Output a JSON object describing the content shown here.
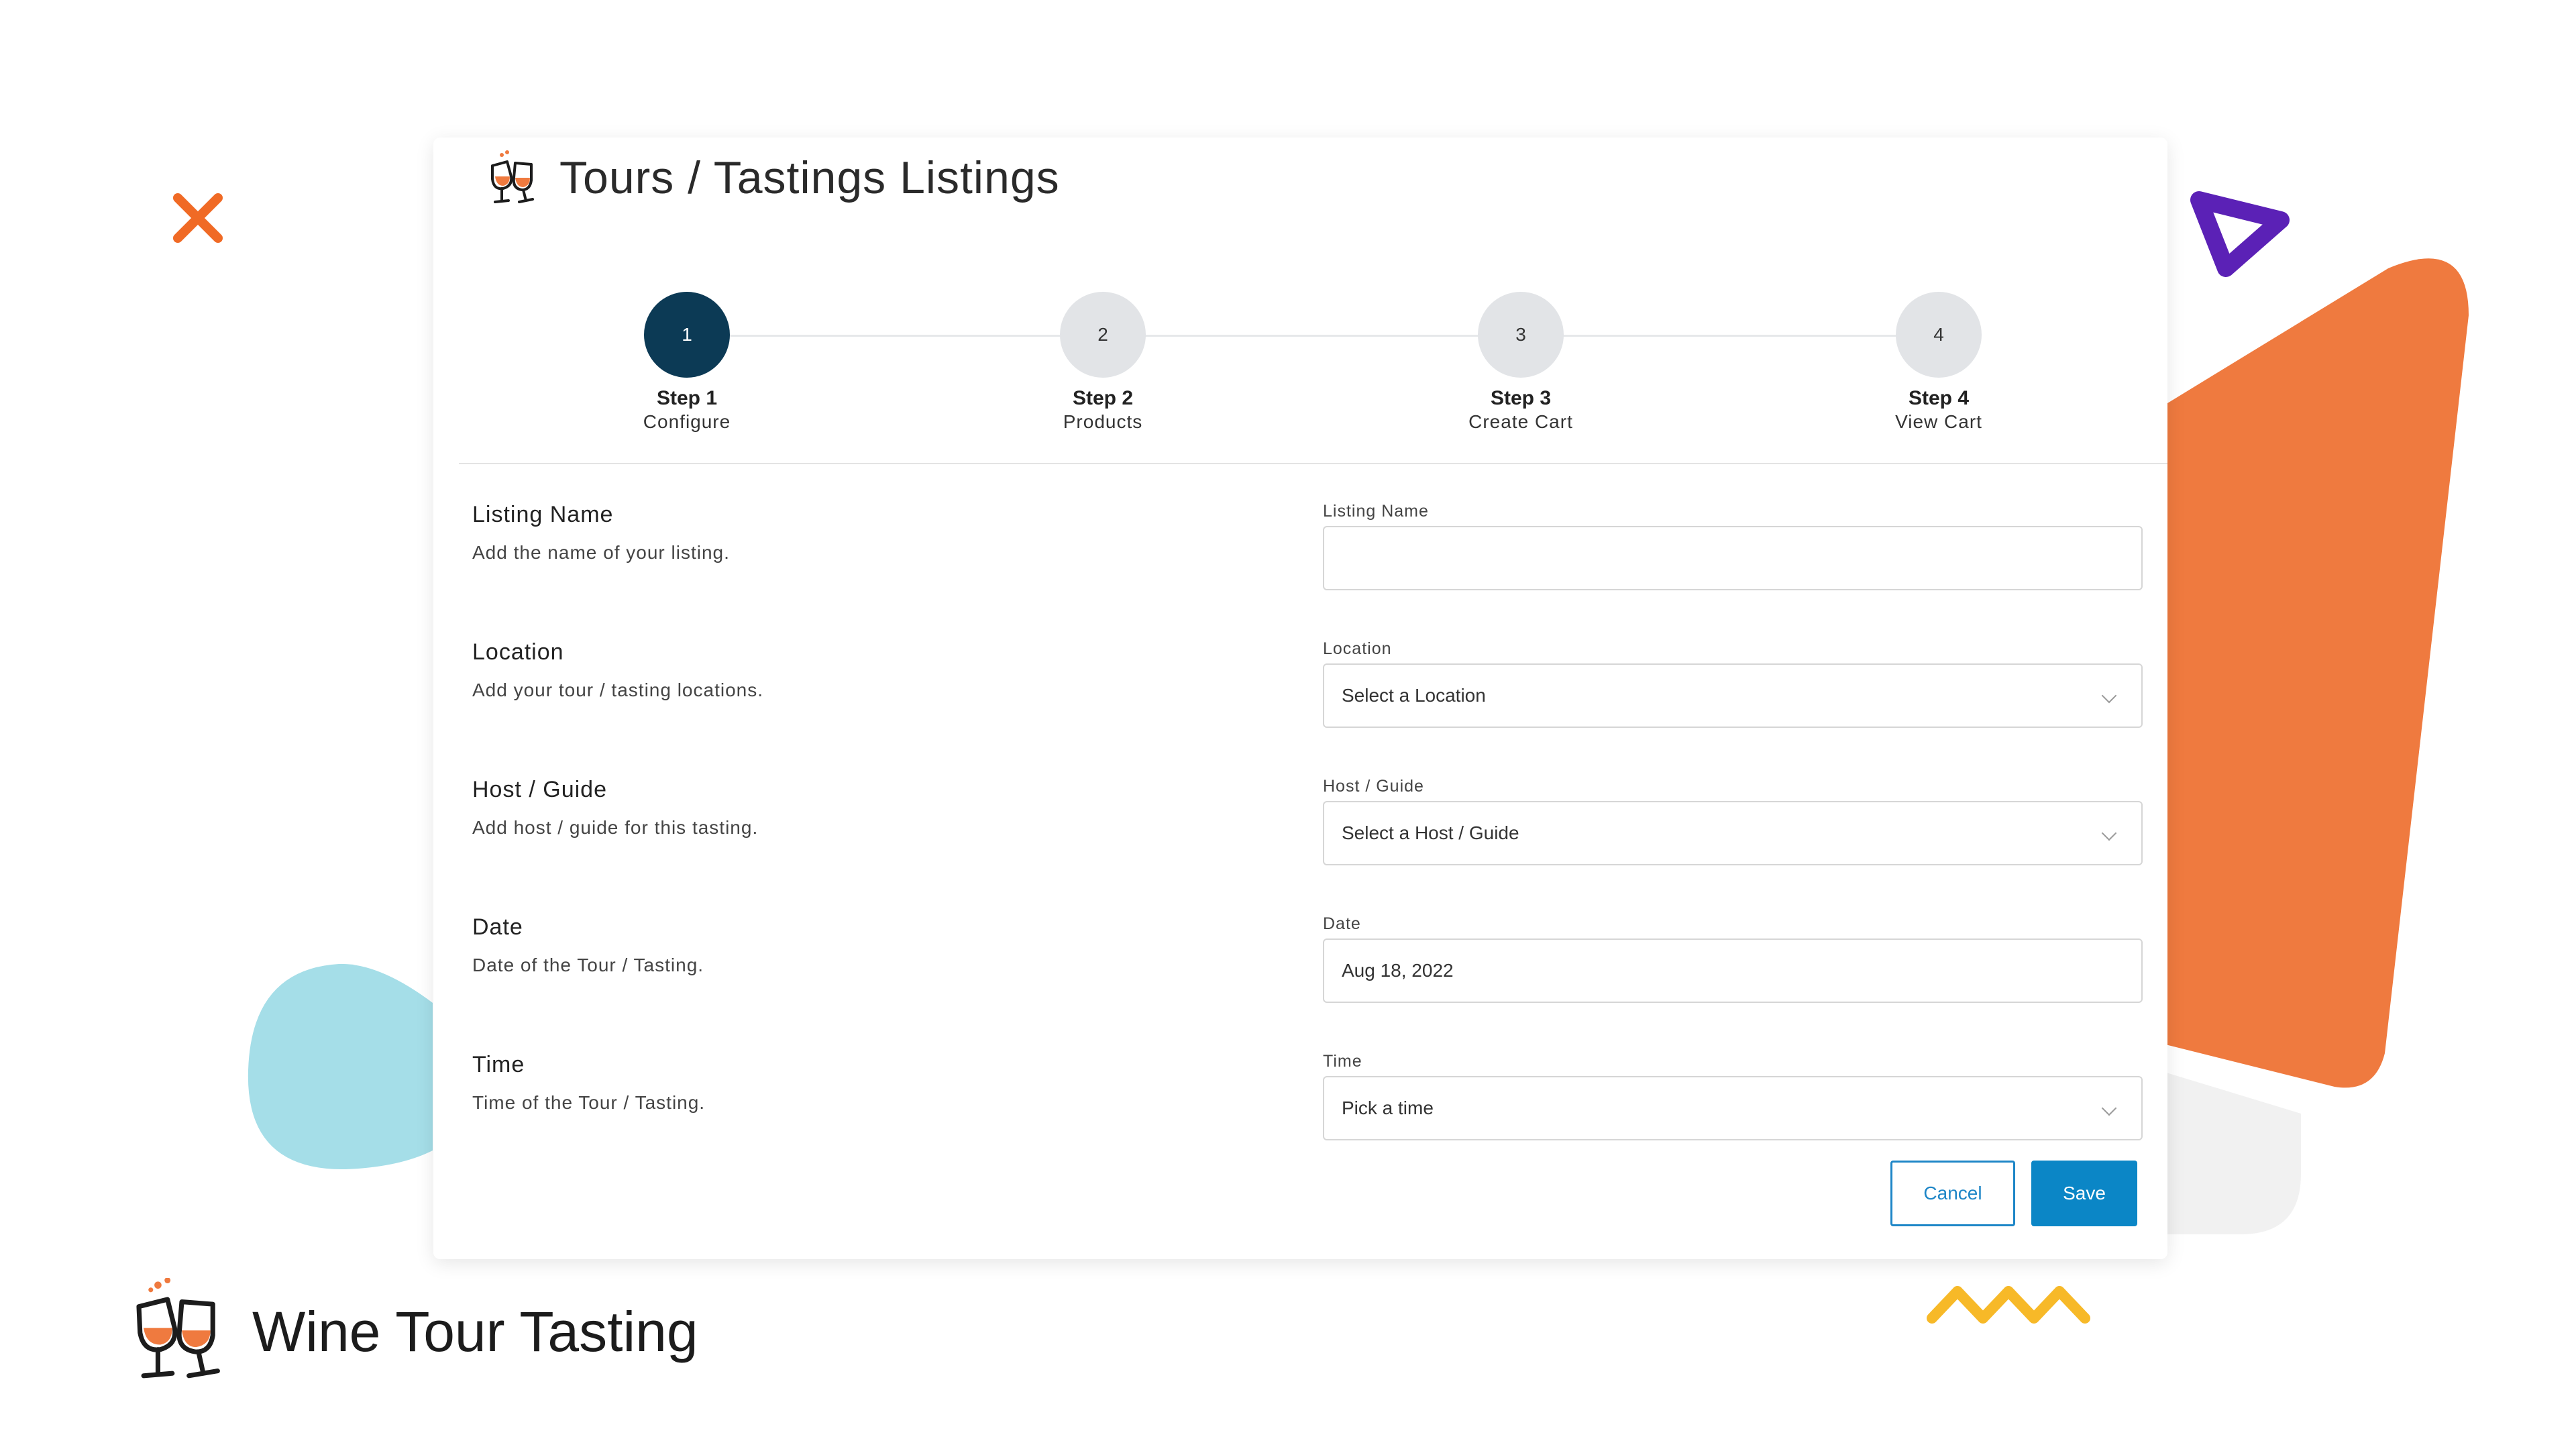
{
  "header": {
    "title": "Tours / Tastings Listings",
    "icon": "wine-glasses-icon"
  },
  "stepper": {
    "steps": [
      {
        "number": "1",
        "label": "Step 1",
        "sub": "Configure",
        "active": true
      },
      {
        "number": "2",
        "label": "Step 2",
        "sub": "Products",
        "active": false
      },
      {
        "number": "3",
        "label": "Step 3",
        "sub": "Create Cart",
        "active": false
      },
      {
        "number": "4",
        "label": "Step 4",
        "sub": "View Cart",
        "active": false
      }
    ]
  },
  "form": {
    "rows": [
      {
        "label": "Listing Name",
        "desc": "Add the name of your listing.",
        "field_label": "Listing Name",
        "value": "",
        "type": "text"
      },
      {
        "label": "Location",
        "desc": "Add your tour / tasting locations.",
        "field_label": "Location",
        "value": "Select a Location",
        "type": "select"
      },
      {
        "label": "Host / Guide",
        "desc": "Add host / guide for this tasting.",
        "field_label": "Host / Guide",
        "value": "Select a Host / Guide",
        "type": "select"
      },
      {
        "label": "Date",
        "desc": "Date of the Tour / Tasting.",
        "field_label": "Date",
        "value": "Aug 18, 2022",
        "type": "date"
      },
      {
        "label": "Time",
        "desc": "Time of the Tour / Tasting.",
        "field_label": "Time",
        "value": "Pick a time",
        "type": "select"
      }
    ],
    "cancel_label": "Cancel",
    "save_label": "Save"
  },
  "brand": {
    "name": "Wine Tour Tasting",
    "icon": "wine-glasses-icon"
  },
  "colors": {
    "accent": "#0B86C6",
    "step_active": "#0C3A55",
    "decor_orange": "#EF7A3F",
    "decor_purple": "#5B21B6",
    "decor_blue": "#A5DEE8",
    "decor_yellow": "#F7B928"
  }
}
